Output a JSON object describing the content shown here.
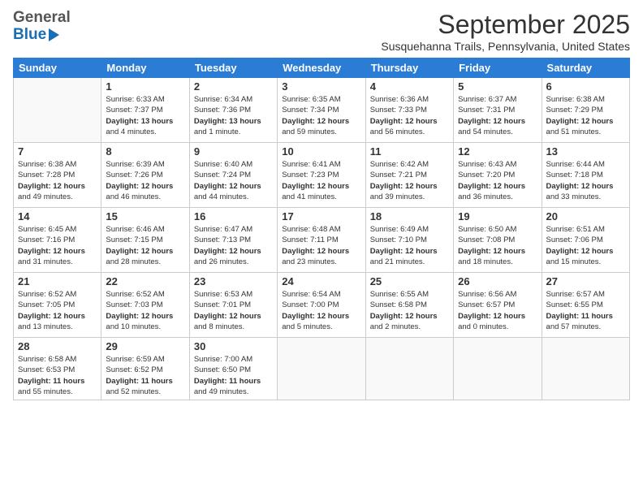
{
  "header": {
    "logo_general": "General",
    "logo_blue": "Blue",
    "month_title": "September 2025",
    "subtitle": "Susquehanna Trails, Pennsylvania, United States"
  },
  "weekdays": [
    "Sunday",
    "Monday",
    "Tuesday",
    "Wednesday",
    "Thursday",
    "Friday",
    "Saturday"
  ],
  "weeks": [
    [
      {
        "day": "",
        "info": ""
      },
      {
        "day": "1",
        "info": "Sunrise: 6:33 AM\nSunset: 7:37 PM\nDaylight: 13 hours\nand 4 minutes."
      },
      {
        "day": "2",
        "info": "Sunrise: 6:34 AM\nSunset: 7:36 PM\nDaylight: 13 hours\nand 1 minute."
      },
      {
        "day": "3",
        "info": "Sunrise: 6:35 AM\nSunset: 7:34 PM\nDaylight: 12 hours\nand 59 minutes."
      },
      {
        "day": "4",
        "info": "Sunrise: 6:36 AM\nSunset: 7:33 PM\nDaylight: 12 hours\nand 56 minutes."
      },
      {
        "day": "5",
        "info": "Sunrise: 6:37 AM\nSunset: 7:31 PM\nDaylight: 12 hours\nand 54 minutes."
      },
      {
        "day": "6",
        "info": "Sunrise: 6:38 AM\nSunset: 7:29 PM\nDaylight: 12 hours\nand 51 minutes."
      }
    ],
    [
      {
        "day": "7",
        "info": "Sunrise: 6:38 AM\nSunset: 7:28 PM\nDaylight: 12 hours\nand 49 minutes."
      },
      {
        "day": "8",
        "info": "Sunrise: 6:39 AM\nSunset: 7:26 PM\nDaylight: 12 hours\nand 46 minutes."
      },
      {
        "day": "9",
        "info": "Sunrise: 6:40 AM\nSunset: 7:24 PM\nDaylight: 12 hours\nand 44 minutes."
      },
      {
        "day": "10",
        "info": "Sunrise: 6:41 AM\nSunset: 7:23 PM\nDaylight: 12 hours\nand 41 minutes."
      },
      {
        "day": "11",
        "info": "Sunrise: 6:42 AM\nSunset: 7:21 PM\nDaylight: 12 hours\nand 39 minutes."
      },
      {
        "day": "12",
        "info": "Sunrise: 6:43 AM\nSunset: 7:20 PM\nDaylight: 12 hours\nand 36 minutes."
      },
      {
        "day": "13",
        "info": "Sunrise: 6:44 AM\nSunset: 7:18 PM\nDaylight: 12 hours\nand 33 minutes."
      }
    ],
    [
      {
        "day": "14",
        "info": "Sunrise: 6:45 AM\nSunset: 7:16 PM\nDaylight: 12 hours\nand 31 minutes."
      },
      {
        "day": "15",
        "info": "Sunrise: 6:46 AM\nSunset: 7:15 PM\nDaylight: 12 hours\nand 28 minutes."
      },
      {
        "day": "16",
        "info": "Sunrise: 6:47 AM\nSunset: 7:13 PM\nDaylight: 12 hours\nand 26 minutes."
      },
      {
        "day": "17",
        "info": "Sunrise: 6:48 AM\nSunset: 7:11 PM\nDaylight: 12 hours\nand 23 minutes."
      },
      {
        "day": "18",
        "info": "Sunrise: 6:49 AM\nSunset: 7:10 PM\nDaylight: 12 hours\nand 21 minutes."
      },
      {
        "day": "19",
        "info": "Sunrise: 6:50 AM\nSunset: 7:08 PM\nDaylight: 12 hours\nand 18 minutes."
      },
      {
        "day": "20",
        "info": "Sunrise: 6:51 AM\nSunset: 7:06 PM\nDaylight: 12 hours\nand 15 minutes."
      }
    ],
    [
      {
        "day": "21",
        "info": "Sunrise: 6:52 AM\nSunset: 7:05 PM\nDaylight: 12 hours\nand 13 minutes."
      },
      {
        "day": "22",
        "info": "Sunrise: 6:52 AM\nSunset: 7:03 PM\nDaylight: 12 hours\nand 10 minutes."
      },
      {
        "day": "23",
        "info": "Sunrise: 6:53 AM\nSunset: 7:01 PM\nDaylight: 12 hours\nand 8 minutes."
      },
      {
        "day": "24",
        "info": "Sunrise: 6:54 AM\nSunset: 7:00 PM\nDaylight: 12 hours\nand 5 minutes."
      },
      {
        "day": "25",
        "info": "Sunrise: 6:55 AM\nSunset: 6:58 PM\nDaylight: 12 hours\nand 2 minutes."
      },
      {
        "day": "26",
        "info": "Sunrise: 6:56 AM\nSunset: 6:57 PM\nDaylight: 12 hours\nand 0 minutes."
      },
      {
        "day": "27",
        "info": "Sunrise: 6:57 AM\nSunset: 6:55 PM\nDaylight: 11 hours\nand 57 minutes."
      }
    ],
    [
      {
        "day": "28",
        "info": "Sunrise: 6:58 AM\nSunset: 6:53 PM\nDaylight: 11 hours\nand 55 minutes."
      },
      {
        "day": "29",
        "info": "Sunrise: 6:59 AM\nSunset: 6:52 PM\nDaylight: 11 hours\nand 52 minutes."
      },
      {
        "day": "30",
        "info": "Sunrise: 7:00 AM\nSunset: 6:50 PM\nDaylight: 11 hours\nand 49 minutes."
      },
      {
        "day": "",
        "info": ""
      },
      {
        "day": "",
        "info": ""
      },
      {
        "day": "",
        "info": ""
      },
      {
        "day": "",
        "info": ""
      }
    ]
  ]
}
